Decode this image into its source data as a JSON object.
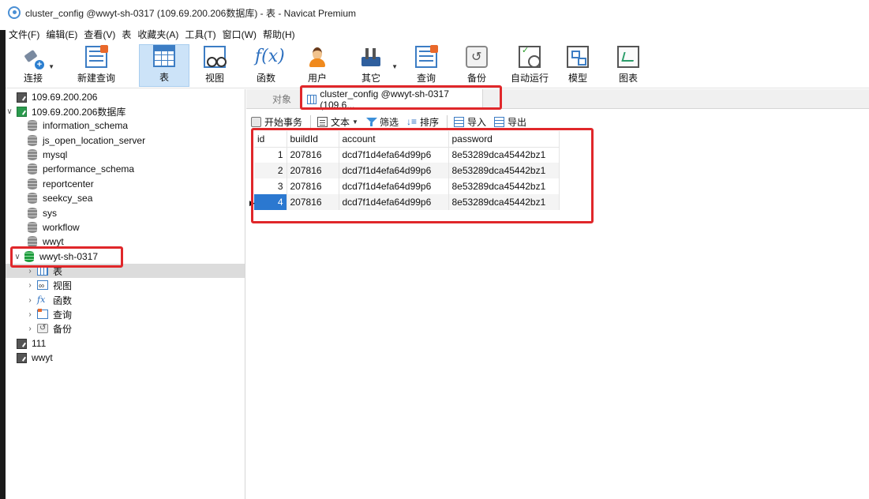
{
  "window": {
    "title": "cluster_config @wwyt-sh-0317 (109.69.200.206数据库) - 表 - Navicat Premium"
  },
  "menu": [
    "文件(F)",
    "编辑(E)",
    "查看(V)",
    "表",
    "收藏夹(A)",
    "工具(T)",
    "窗口(W)",
    "帮助(H)"
  ],
  "toolbar": {
    "connect": "连接",
    "new_query": "新建查询",
    "table": "表",
    "view": "视图",
    "function": "函数",
    "user": "用户",
    "other": "其它",
    "query": "查询",
    "backup": "备份",
    "auto_run": "自动运行",
    "model": "模型",
    "chart": "图表",
    "fx_glyph": "f(x)"
  },
  "tree": {
    "conn1": "109.69.200.206",
    "conn2": "109.69.200.206数据库",
    "databases": [
      "information_schema",
      "js_open_location_server",
      "mysql",
      "performance_schema",
      "reportcenter",
      "seekcy_sea",
      "sys",
      "workflow",
      "wwyt"
    ],
    "open_db": "wwyt-sh-0317",
    "children": {
      "table": "表",
      "view": "视图",
      "function": "函数",
      "query": "查询",
      "backup": "备份"
    },
    "conn3": "111",
    "conn4": "wwyt"
  },
  "tabs": {
    "objects": "对象",
    "active": "cluster_config @wwyt-sh-0317 (109.6..."
  },
  "subtoolbar": {
    "begin_txn": "开始事务",
    "text": "文本",
    "filter": "筛选",
    "sort": "排序",
    "import": "导入",
    "export": "导出"
  },
  "grid": {
    "columns": [
      "id",
      "buildId",
      "account",
      "password"
    ],
    "rows": [
      [
        "1",
        "207816",
        "dcd7f1d4efa64d99p6",
        "8e53289dca45442bz1"
      ],
      [
        "2",
        "207816",
        "dcd7f1d4efa64d99p6",
        "8e53289dca45442bz1"
      ],
      [
        "3",
        "207816",
        "dcd7f1d4efa64d99p6",
        "8e53289dca45442bz1"
      ],
      [
        "4",
        "207816",
        "dcd7f1d4efa64d99p6",
        "8e53289dca45442bz1"
      ]
    ],
    "selected_row": 4
  },
  "colors": {
    "accent": "#2b78d0",
    "highlight": "#e0272a",
    "active_tool": "#cce3f8"
  }
}
